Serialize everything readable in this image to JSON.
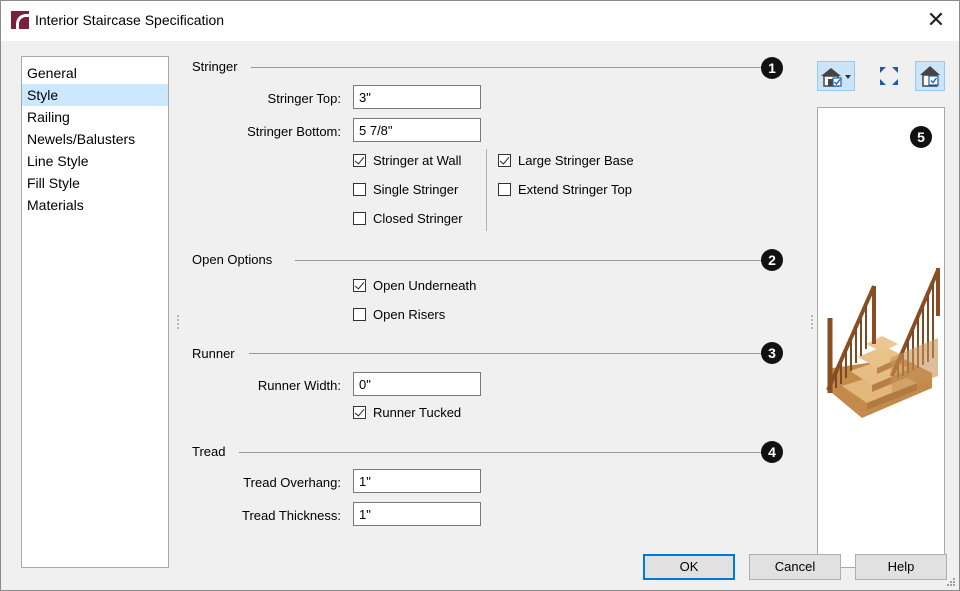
{
  "window": {
    "title": "Interior Staircase Specification"
  },
  "nav": {
    "items": [
      "General",
      "Style",
      "Railing",
      "Newels/Balusters",
      "Line Style",
      "Fill Style",
      "Materials"
    ],
    "selected": "Style"
  },
  "sections": {
    "stringer": {
      "title": "Stringer",
      "badge": "1",
      "top_label": "Stringer Top:",
      "top_value": "3\"",
      "bottom_label": "Stringer Bottom:",
      "bottom_value": "5 7/8\"",
      "checks": {
        "at_wall": {
          "label": "Stringer at Wall",
          "checked": true
        },
        "single": {
          "label": "Single Stringer",
          "checked": false
        },
        "closed": {
          "label": "Closed Stringer",
          "checked": false
        },
        "large_base": {
          "label": "Large Stringer Base",
          "checked": true
        },
        "extend_top": {
          "label": "Extend Stringer Top",
          "checked": false
        }
      }
    },
    "open_options": {
      "title": "Open Options",
      "badge": "2",
      "checks": {
        "open_underneath": {
          "label": "Open Underneath",
          "checked": true
        },
        "open_risers": {
          "label": "Open Risers",
          "checked": false
        }
      }
    },
    "runner": {
      "title": "Runner",
      "badge": "3",
      "width_label": "Runner Width:",
      "width_value": "0\"",
      "tucked": {
        "label": "Runner Tucked",
        "checked": true
      }
    },
    "tread": {
      "title": "Tread",
      "badge": "4",
      "overhang_label": "Tread Overhang:",
      "overhang_value": "1\"",
      "thickness_label": "Tread Thickness:",
      "thickness_value": "1\""
    }
  },
  "preview": {
    "badge": "5"
  },
  "buttons": {
    "ok": "OK",
    "cancel": "Cancel",
    "help": "Help"
  },
  "colors": {
    "selected_bg": "#cce8ff",
    "toolbar_active": "#cce4f7",
    "wood": "#d9a86c",
    "badge": "#111111"
  }
}
